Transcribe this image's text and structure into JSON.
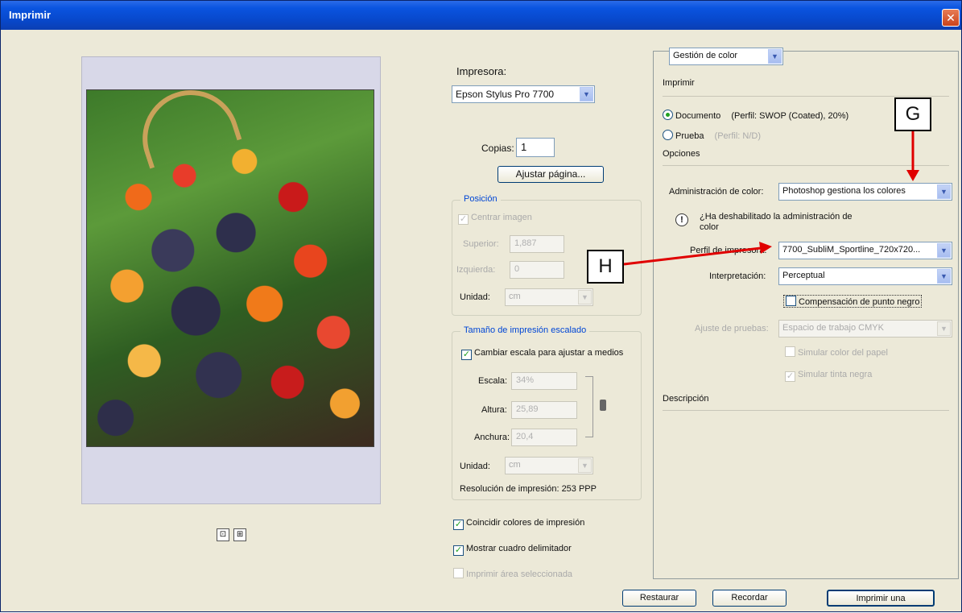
{
  "window": {
    "title": "Imprimir",
    "close_glyph": "✕"
  },
  "preview": {
    "icons": [
      "⊡",
      "⊞"
    ]
  },
  "printer": {
    "label": "Impresora:",
    "selected": "Epson Stylus Pro 7700",
    "copies_label": "Copias:",
    "copies_value": "1",
    "fit_page_button": "Ajustar página..."
  },
  "position": {
    "legend": "Posición",
    "center_image": "Centrar imagen",
    "top_label": "Superior:",
    "top_value": "1,887",
    "left_label": "Izquierda:",
    "left_value": "0",
    "unit_label": "Unidad:",
    "unit_value": "cm"
  },
  "scaled": {
    "legend": "Tamaño de impresión escalado",
    "fit_media": "Cambiar escala para ajustar a medios",
    "scale_label": "Escala:",
    "scale_value": "34%",
    "height_label": "Altura:",
    "height_value": "25,89",
    "width_label": "Anchura:",
    "width_value": "20,4",
    "unit_label": "Unidad:",
    "unit_value": "cm",
    "resolution": "Resolución de impresión: 253 PPP"
  },
  "options_bottom": {
    "match_colors": "Coincidir colores de impresión",
    "show_bounding": "Mostrar cuadro delimitador",
    "print_selected": "Imprimir área seleccionada"
  },
  "color_panel": {
    "mode": "Gestión de color",
    "print_label": "Imprimir",
    "document_radio": "Documento",
    "document_profile": "(Perfil: SWOP (Coated), 20%)",
    "proof_radio": "Prueba",
    "proof_profile": "(Perfil: N/D)",
    "options_label": "Opciones",
    "color_handling_label": "Administración de color:",
    "color_handling_value": "Photoshop gestiona los colores",
    "warning_glyph": "!",
    "warning_text": "¿Ha deshabilitado la administración de color",
    "printer_profile_label": "Perfil de impresora:",
    "printer_profile_value": "7700_SubliM_Sportline_720x720...",
    "intent_label": "Interpretación:",
    "intent_value": "Perceptual",
    "black_point": "Compensación de punto negro",
    "proof_setup_label": "Ajuste de pruebas:",
    "proof_setup_value": "Espacio de trabajo CMYK",
    "simulate_paper": "Simular color del papel",
    "simulate_ink": "Simular tinta negra",
    "description_label": "Descripción"
  },
  "footer": {
    "restore": "Restaurar",
    "remember": "Recordar",
    "print_one": "Imprimir una"
  },
  "annotations": {
    "g": "G",
    "h": "H",
    "arrow_color": "#e00000"
  }
}
